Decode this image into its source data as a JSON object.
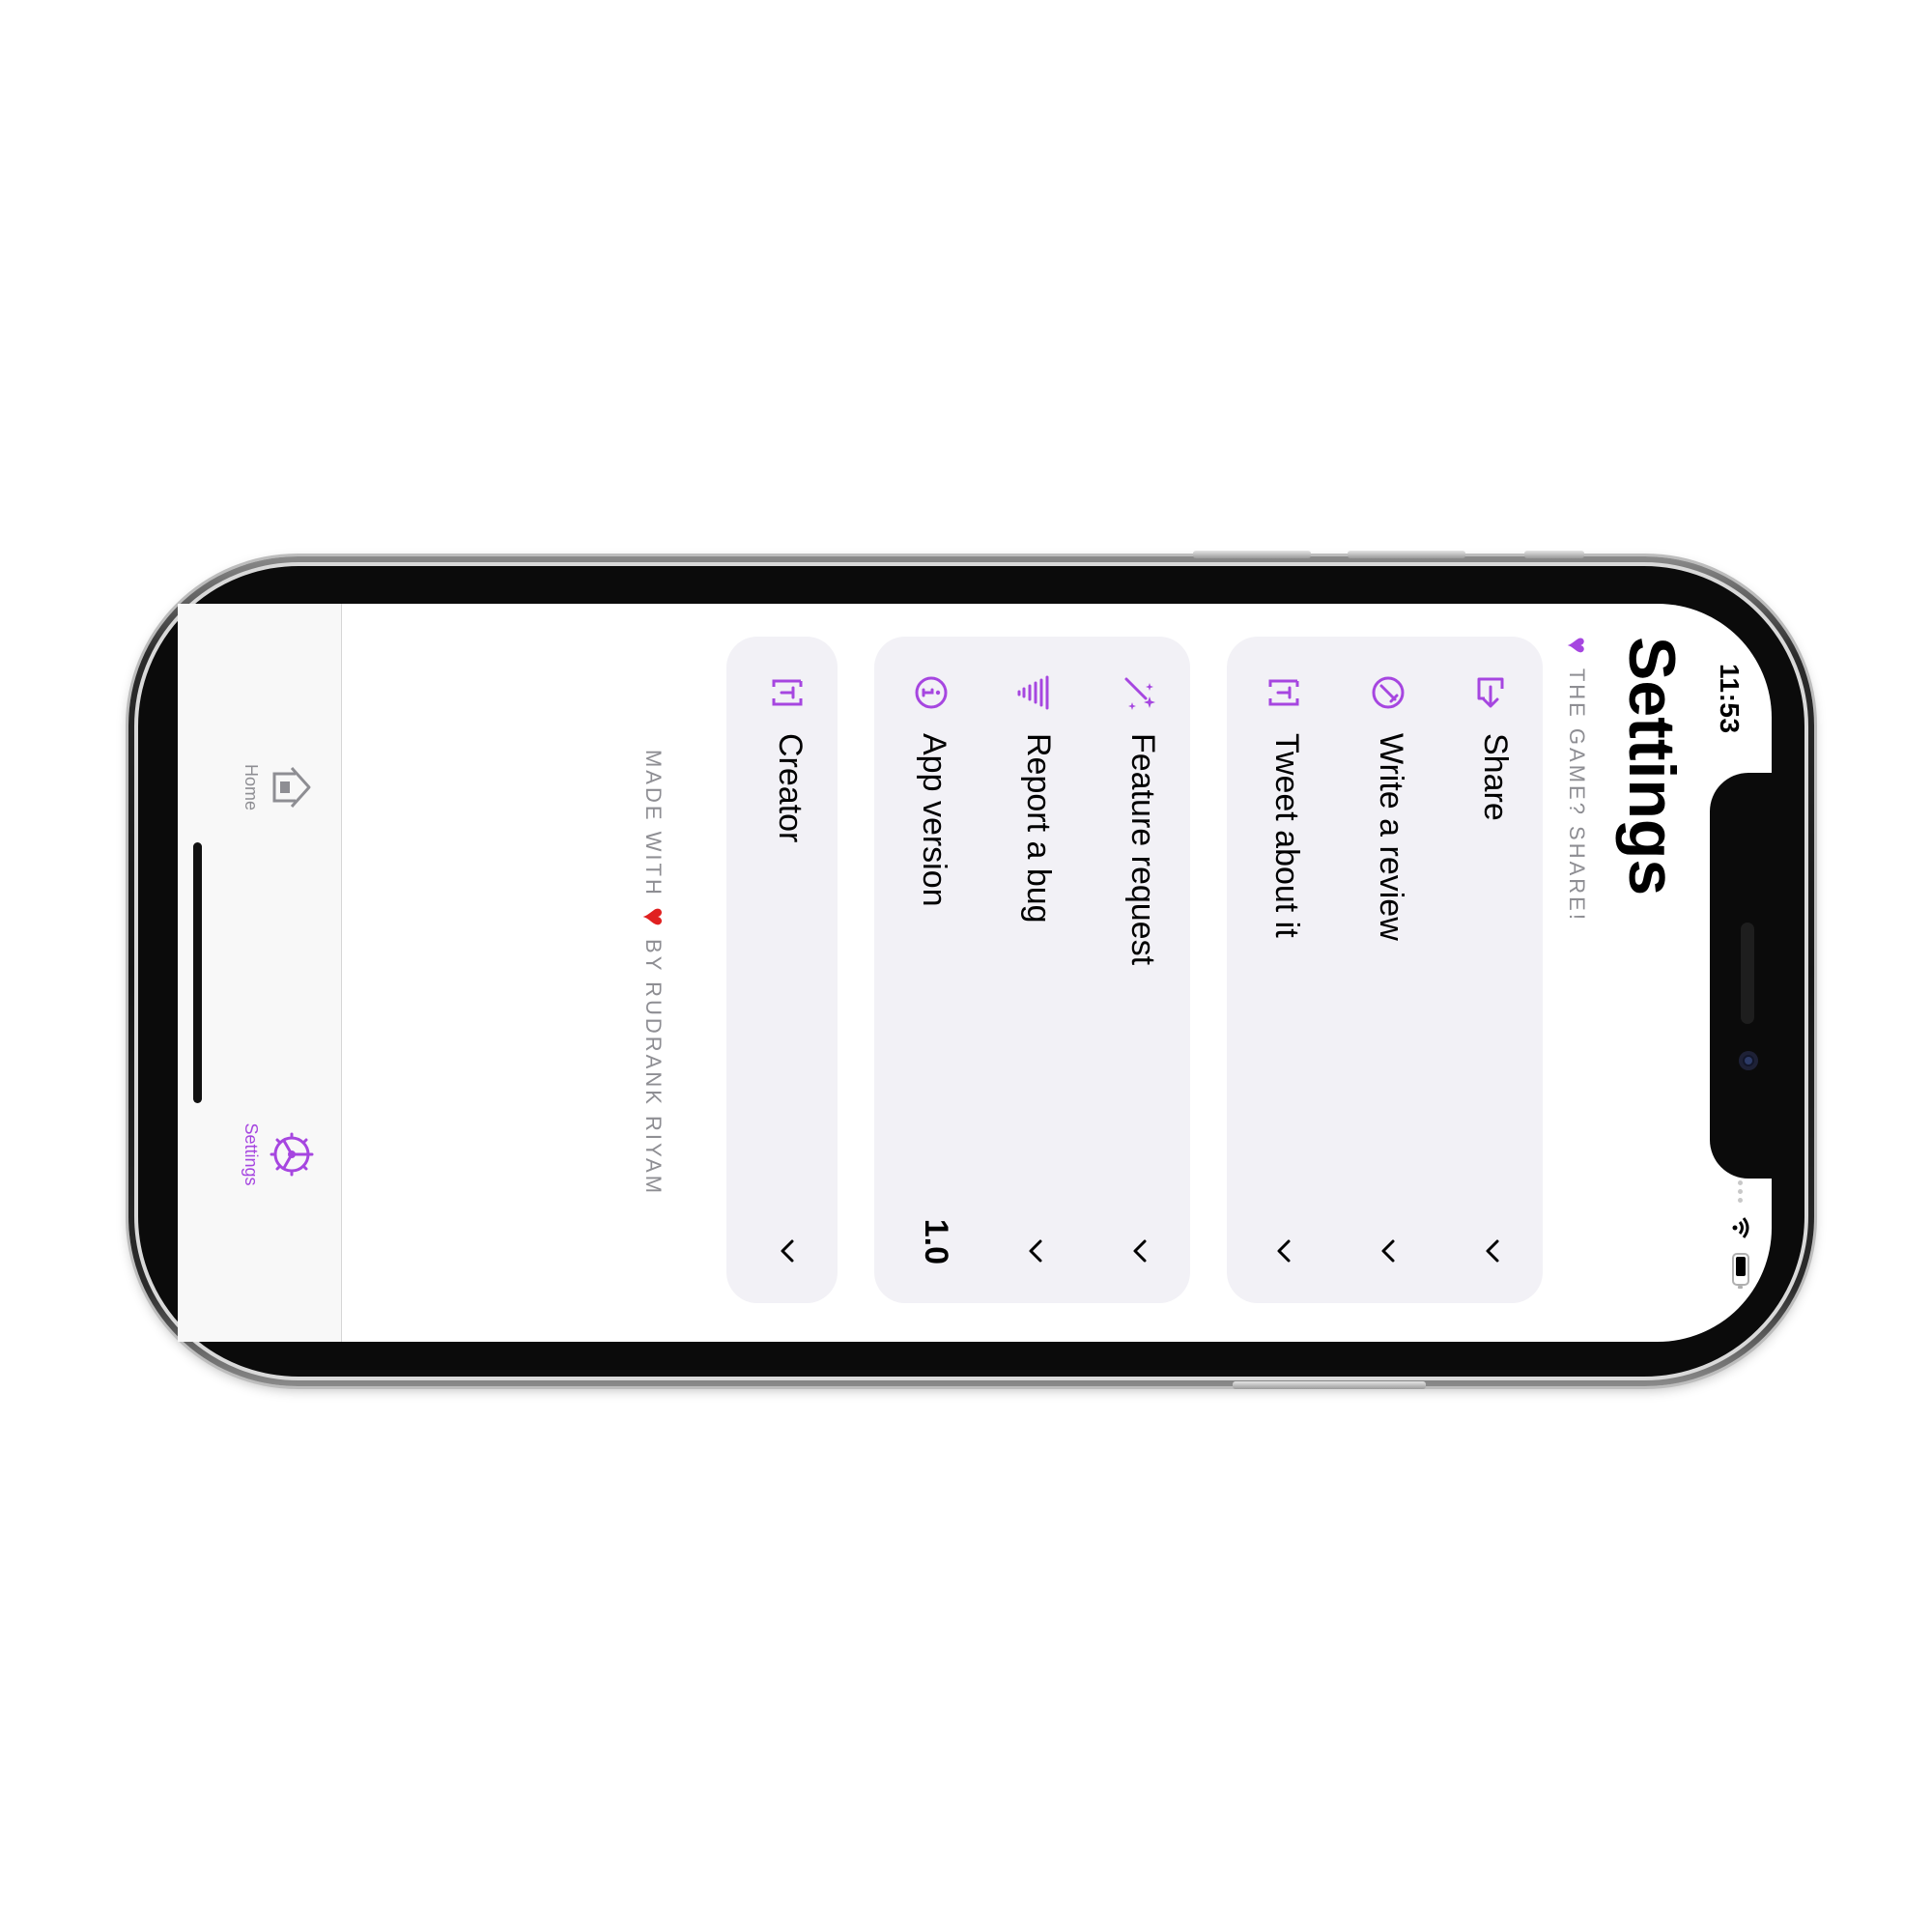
{
  "status_bar": {
    "time": "11:53"
  },
  "header": {
    "title": "Settings",
    "subtitle": "THE GAME? SHARE!"
  },
  "sections": [
    {
      "rows": [
        {
          "icon": "share-icon",
          "label": "Share"
        },
        {
          "icon": "review-icon",
          "label": "Write a review"
        },
        {
          "icon": "tweet-icon",
          "label": "Tweet about it"
        }
      ]
    },
    {
      "rows": [
        {
          "icon": "magic-wand-icon",
          "label": "Feature request"
        },
        {
          "icon": "tornado-icon",
          "label": "Report a bug"
        },
        {
          "icon": "info-icon",
          "label": "App version",
          "value": "1.0"
        }
      ]
    },
    {
      "rows": [
        {
          "icon": "creator-icon",
          "label": "Creator"
        }
      ]
    }
  ],
  "footer": {
    "prefix": "MADE WITH",
    "suffix": "BY RUDRANK RIYAM"
  },
  "tabbar": {
    "tabs": [
      {
        "icon": "home-icon",
        "label": "Home",
        "active": false
      },
      {
        "icon": "gear-icon",
        "label": "Settings",
        "active": true
      }
    ]
  },
  "colors": {
    "accent": "#a646e0",
    "card": "#f2f1f6",
    "heart_footer": "#e02020"
  }
}
